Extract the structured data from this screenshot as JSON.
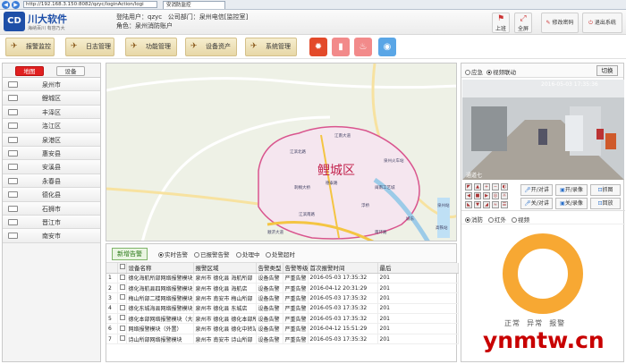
{
  "browser": {
    "address": "http://192.168.3.150:8082/qzyc/loginAction/logi",
    "tab_title": "安消防监控"
  },
  "header": {
    "logo_mark": "CD",
    "logo_name": "川大软件",
    "logo_slogan": "海纳百川 有容乃大",
    "user_label": "登陆用户：",
    "user_value": "qzyc",
    "dept_label": "公司部门：",
    "dept_value": "泉州电信[监控室]",
    "role_label": "角色：",
    "role_value": "泉州消防账户",
    "buttons": [
      {
        "label": "上班"
      },
      {
        "label": "全屏"
      },
      {
        "label": "修改密码"
      },
      {
        "label": "退出系统"
      }
    ]
  },
  "menu": {
    "items": [
      {
        "label": "报警监控"
      },
      {
        "label": "日志管理"
      },
      {
        "label": "功能管理"
      },
      {
        "label": "设备资产"
      },
      {
        "label": "系统管理"
      }
    ]
  },
  "quick_colors": [
    "#e34a2a",
    "#f28a8a",
    "#f28a8a",
    "#5aa6e6"
  ],
  "left": {
    "tabs": [
      {
        "label": "地图"
      },
      {
        "label": "设备"
      }
    ],
    "cities": [
      "泉州市",
      "鲤城区",
      "丰泽区",
      "洛江区",
      "泉港区",
      "惠安县",
      "安溪县",
      "永春县",
      "德化县",
      "石狮市",
      "晋江市",
      "南安市"
    ]
  },
  "map": {
    "district_label": "鲤城区",
    "place_labels": [
      "江南大道",
      "江滨北路",
      "刺桐大桥",
      "德泰路",
      "闽南工艺城",
      "泉州火车站",
      "泉州站",
      "城东",
      "浮桥",
      "高铁站",
      "江滨南路",
      "顺济大道",
      "南环路"
    ]
  },
  "alarm": {
    "new_button": "新增告警",
    "filters": [
      {
        "label": "实时告警",
        "on": true
      },
      {
        "label": "已报警告警",
        "on": false
      },
      {
        "label": "处理中",
        "on": false
      },
      {
        "label": "处警超时",
        "on": false
      }
    ],
    "columns": [
      "",
      "",
      "设备名称",
      "报警区域",
      "告警类型",
      "告警等级",
      "首次报警时间",
      "最后"
    ],
    "rows": [
      [
        "1",
        "德化海航所部网络报警模块",
        "泉州市 德化县 海航所部",
        "设备告警",
        "严重告警",
        "2016-05-03 17:35:32",
        "201"
      ],
      [
        "2",
        "德化海航县四网络报警模块",
        "泉州市 德化县 海航店",
        "设备告警",
        "严重告警",
        "2016-04-12 20:31:29",
        "201"
      ],
      [
        "3",
        "梅山所部二楼网络报警模块",
        "泉州市 南安市 梅山所部",
        "设备告警",
        "严重告警",
        "2016-05-03 17:35:32",
        "201"
      ],
      [
        "4",
        "德化东城海县网络报警模块",
        "泉州市 德化县 东城店",
        "设备告警",
        "严重告警",
        "2016-05-03 17:35:32",
        "201"
      ],
      [
        "5",
        "德化本部网络报警模块（大楼）",
        "泉州市 德化县 德化本部所部",
        "设备告警",
        "严重告警",
        "2016-05-03 17:35:32",
        "201"
      ],
      [
        "6",
        "网络报警模块（外置）",
        "泉州市 德化县 德化中转站",
        "设备告警",
        "严重告警",
        "2016-04-12 15:51:29",
        "201"
      ],
      [
        "7",
        "诗山所部网络报警模块",
        "泉州市 南安市 诗山所部",
        "设备告警",
        "严重告警",
        "2016-05-03 17:35:32",
        "201"
      ]
    ]
  },
  "right": {
    "options": [
      {
        "label": "应急",
        "on": false
      },
      {
        "label": "视频联动",
        "on": true
      }
    ],
    "switch_label": "切换",
    "video_timestamp": "2016-05-03 17:35:36",
    "video_channel": "通道七",
    "ptz_buttons": [
      {
        "label": "开/对讲"
      },
      {
        "label": "开/录像"
      },
      {
        "label": "抓图"
      },
      {
        "label": "关/对讲"
      },
      {
        "label": "关/录像"
      },
      {
        "label": "回放"
      }
    ],
    "stat_options": [
      {
        "label": "消防",
        "on": true
      },
      {
        "label": "红外",
        "on": false
      },
      {
        "label": "视频",
        "on": false
      }
    ],
    "chart_labels": [
      "正常",
      "异常",
      "报警"
    ]
  },
  "chart_data": {
    "type": "pie",
    "title": "",
    "categories": [
      "正常",
      "异常",
      "报警"
    ],
    "values": [
      100,
      0,
      0
    ],
    "colors": [
      "#f7a833",
      "#e0e0e0",
      "#e0e0e0"
    ]
  },
  "watermark": "ynmtw.cn"
}
